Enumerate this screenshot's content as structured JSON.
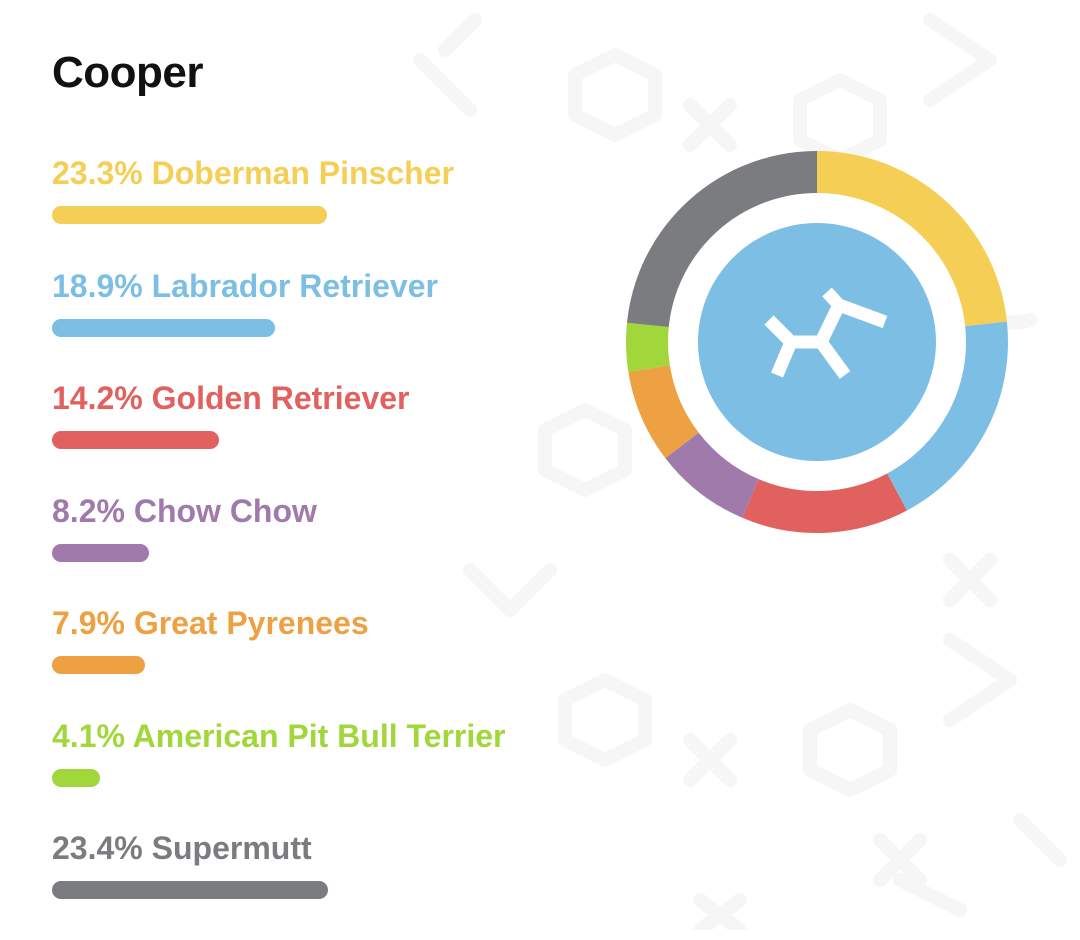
{
  "dog": {
    "name": "Cooper"
  },
  "chart_data": {
    "type": "pie",
    "title": "",
    "center_icon": "embark-logo-icon",
    "center_color": "#7DBFE4",
    "bar_scale_max_percent": 23.4,
    "slices": [
      {
        "label": "Doberman Pinscher",
        "percent": 23.3,
        "percent_text": "23.3%",
        "color": "#F5CE55"
      },
      {
        "label": "Labrador Retriever",
        "percent": 18.9,
        "percent_text": "18.9%",
        "color": "#7DBFE4"
      },
      {
        "label": "Golden Retriever",
        "percent": 14.2,
        "percent_text": "14.2%",
        "color": "#E1615E"
      },
      {
        "label": "Chow Chow",
        "percent": 8.2,
        "percent_text": "8.2%",
        "color": "#A07AAA"
      },
      {
        "label": "Great Pyrenees",
        "percent": 7.9,
        "percent_text": "7.9%",
        "color": "#EEA142"
      },
      {
        "label": "American Pit Bull Terrier",
        "percent": 4.1,
        "percent_text": "4.1%",
        "color": "#A1D73B"
      },
      {
        "label": "Supermutt",
        "percent": 23.4,
        "percent_text": "23.4%",
        "color": "#7A7C80"
      }
    ]
  }
}
